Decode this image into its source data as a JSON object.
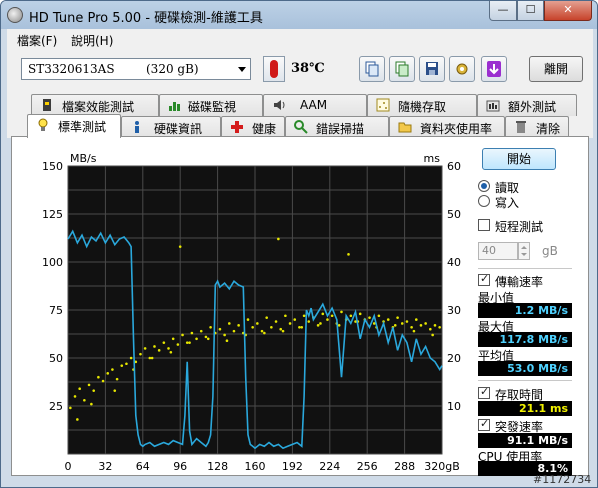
{
  "window": {
    "title": "HD Tune Pro  5.00 - 硬碟檢測-維護工具",
    "controls": {
      "minimize": "—",
      "maximize": "☐",
      "close": "✕"
    }
  },
  "menu": [
    {
      "label": "檔案(F)"
    },
    {
      "label": "說明(H)"
    }
  ],
  "toolbar": {
    "drive": {
      "name": "ST3320613AS",
      "size": "(320 gB)"
    },
    "temperature": "38℃",
    "tool_icons": [
      "copy-info-icon",
      "copy-screen-icon",
      "save-icon",
      "options-icon",
      "download-icon"
    ],
    "exit_label": "離開"
  },
  "tabs": {
    "row1": [
      {
        "label": "檔案效能測試",
        "icon": "file-benchmark-icon"
      },
      {
        "label": "磁碟監視",
        "icon": "disk-monitor-icon"
      },
      {
        "label": "AAM",
        "icon": "speaker-icon"
      },
      {
        "label": "隨機存取",
        "icon": "random-access-icon"
      },
      {
        "label": "額外測試",
        "icon": "extra-tests-icon"
      }
    ],
    "row2": [
      {
        "label": "標準測試",
        "icon": "benchmark-icon",
        "active": true
      },
      {
        "label": "硬碟資訊",
        "icon": "info-icon"
      },
      {
        "label": "健康",
        "icon": "health-cross-icon"
      },
      {
        "label": "錯誤掃描",
        "icon": "error-scan-icon"
      },
      {
        "label": "資料夾使用率",
        "icon": "folder-usage-icon"
      },
      {
        "label": "清除",
        "icon": "erase-icon"
      }
    ]
  },
  "side": {
    "start_label": "開始",
    "read_label": "讀取",
    "write_label": "寫入",
    "read_selected": true,
    "short_test_label": "短程測試",
    "short_test_checked": false,
    "short_test_size": "40",
    "short_test_unit": "gB",
    "transfer_rate_label": "傳輸速率",
    "transfer_rate_checked": true,
    "min_label": "最小值",
    "min_value": "1.2 MB/s",
    "max_label": "最大值",
    "max_value": "117.8 MB/s",
    "avg_label": "平均值",
    "avg_value": "53.0 MB/s",
    "access_time_label": "存取時間",
    "access_time_checked": true,
    "access_time_value": "21.1 ms",
    "burst_label": "突發速率",
    "burst_checked": true,
    "burst_value": "91.1 MB/s",
    "cpu_label": "CPU 使用率",
    "cpu_value": "8.1%"
  },
  "chart_data": {
    "type": "line",
    "y_left_label": "MB/s",
    "y_right_label": "ms",
    "x_unit": "gB",
    "x_ticks": [
      "0",
      "32",
      "64",
      "96",
      "128",
      "160",
      "192",
      "224",
      "256",
      "288",
      "320gB"
    ],
    "y_left_ticks": [
      "150",
      "125",
      "100",
      "75",
      "50",
      "25"
    ],
    "y_right_ticks": [
      "60",
      "50",
      "40",
      "30",
      "20",
      "10"
    ],
    "xlim": [
      0,
      320
    ],
    "ylim_left": [
      0,
      150
    ],
    "ylim_right": [
      0,
      60
    ],
    "grid": true,
    "series": [
      {
        "color": "#2aa8dc",
        "x": [
          0,
          4,
          8,
          12,
          16,
          20,
          24,
          28,
          32,
          36,
          40,
          44,
          48,
          52,
          54,
          56,
          58,
          60,
          62,
          64,
          66,
          70,
          74,
          78,
          82,
          86,
          90,
          94,
          98,
          100,
          102,
          104,
          106,
          110,
          114,
          118,
          120,
          122,
          124,
          126,
          128,
          130,
          134,
          138,
          142,
          146,
          150,
          152,
          154,
          156,
          158,
          160,
          164,
          168,
          172,
          176,
          180,
          184,
          188,
          192,
          196,
          200,
          202,
          204,
          206,
          208,
          210,
          214,
          218,
          222,
          226,
          230,
          234,
          238,
          242,
          246,
          250,
          254,
          258,
          262,
          266,
          270,
          274,
          278,
          282,
          286,
          290,
          294,
          298,
          302,
          306,
          310,
          314,
          318,
          320
        ],
        "y": [
          112,
          116,
          110,
          114,
          108,
          113,
          111,
          115,
          110,
          114,
          109,
          112,
          113,
          110,
          108,
          60,
          20,
          10,
          5,
          4,
          5,
          6,
          4,
          5,
          6,
          5,
          7,
          6,
          5,
          20,
          48,
          12,
          5,
          8,
          6,
          4,
          6,
          10,
          30,
          88,
          90,
          87,
          89,
          86,
          90,
          88,
          87,
          40,
          10,
          5,
          4,
          3,
          5,
          4,
          6,
          4,
          5,
          3,
          4,
          5,
          6,
          4,
          30,
          75,
          72,
          76,
          70,
          74,
          78,
          72,
          76,
          70,
          40,
          72,
          68,
          74,
          60,
          70,
          66,
          72,
          62,
          68,
          58,
          66,
          54,
          62,
          58,
          48,
          60,
          52,
          56,
          50,
          48,
          44,
          46
        ]
      },
      {
        "color": "#e6e600",
        "kind": "scatter",
        "x": [
          2,
          6,
          10,
          14,
          18,
          22,
          26,
          30,
          34,
          38,
          42,
          46,
          50,
          54,
          58,
          62,
          66,
          70,
          74,
          78,
          82,
          86,
          90,
          94,
          98,
          102,
          106,
          110,
          114,
          118,
          122,
          126,
          130,
          134,
          138,
          142,
          146,
          150,
          154,
          158,
          162,
          166,
          170,
          174,
          178,
          182,
          186,
          190,
          194,
          198,
          202,
          206,
          210,
          214,
          218,
          222,
          226,
          230,
          234,
          238,
          242,
          246,
          250,
          254,
          258,
          262,
          266,
          270,
          274,
          278,
          282,
          286,
          290,
          294,
          298,
          302,
          306,
          310,
          314,
          318,
          8,
          20,
          40,
          56,
          72,
          88,
          104,
          120,
          136,
          152,
          168,
          184,
          200,
          216,
          232,
          248,
          264,
          280,
          296,
          312,
          96,
          180,
          240
        ],
        "y": [
          24,
          30,
          34,
          28,
          36,
          33,
          40,
          38,
          42,
          44,
          39,
          46,
          47,
          50,
          48,
          52,
          55,
          50,
          56,
          54,
          58,
          55,
          60,
          57,
          62,
          58,
          63,
          60,
          64,
          61,
          66,
          63,
          65,
          62,
          68,
          64,
          67,
          63,
          70,
          66,
          68,
          64,
          71,
          66,
          69,
          65,
          72,
          68,
          70,
          66,
          72,
          69,
          71,
          67,
          73,
          70,
          72,
          68,
          74,
          70,
          72,
          69,
          73,
          70,
          71,
          68,
          72,
          69,
          70,
          66,
          71,
          68,
          69,
          66,
          70,
          67,
          68,
          65,
          67,
          66,
          18,
          26,
          33,
          44,
          50,
          53,
          58,
          60,
          59,
          62,
          63,
          64,
          66,
          68,
          67,
          69,
          66,
          67,
          64,
          62,
          108,
          112,
          104
        ]
      }
    ]
  },
  "watermark": "#1172734"
}
